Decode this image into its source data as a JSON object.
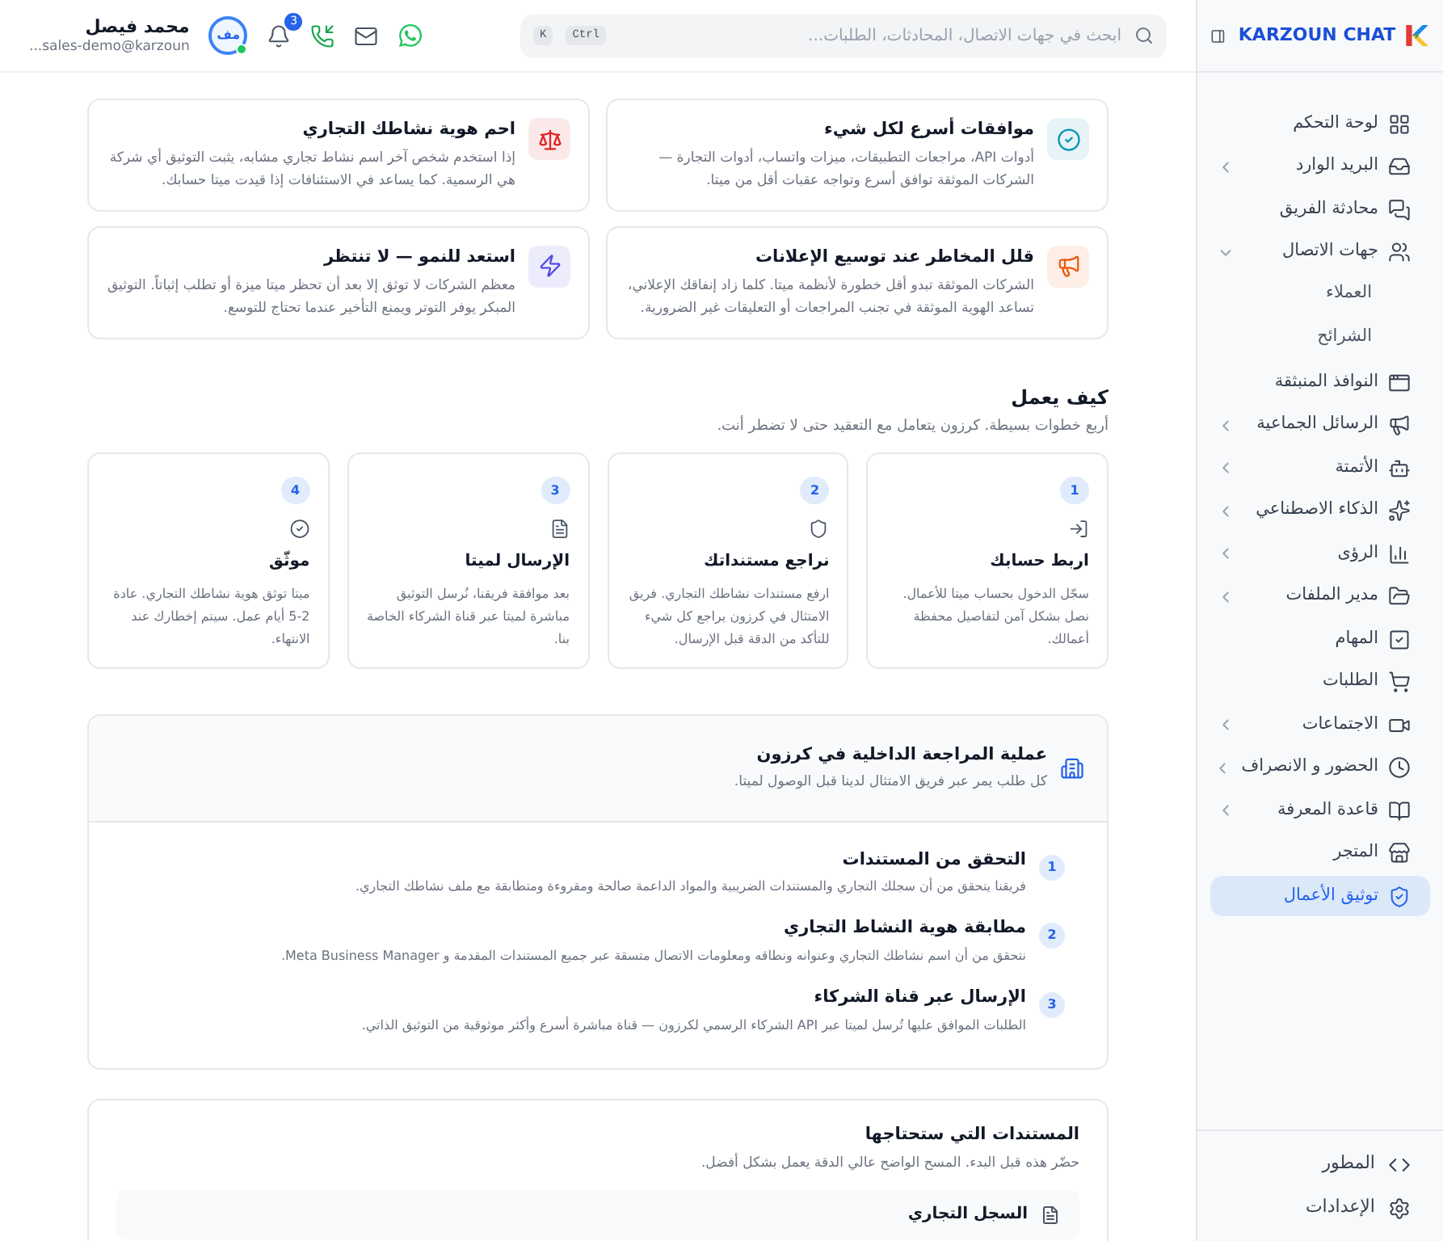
{
  "sidebar": {
    "logo_text": "KARZOUN CHAT",
    "items": [
      {
        "label": "لوحة التحكم",
        "selected": false
      },
      {
        "label": "البريد الوارد",
        "selected": false,
        "expanded": false
      },
      {
        "label": "محادثة الفريق",
        "selected": false
      },
      {
        "label": "جهات الاتصال",
        "selected": false,
        "expanded": true,
        "children": [
          {
            "label": "العملاء",
            "selected": false
          },
          {
            "label": "الشرائح",
            "selected": false
          }
        ]
      },
      {
        "label": "النوافذ المنبثقة",
        "selected": false
      },
      {
        "label": "الرسائل الجماعية",
        "selected": false,
        "expanded": false
      },
      {
        "label": "الأتمتة",
        "selected": false,
        "expanded": false
      },
      {
        "label": "الذكاء الاصطناعي",
        "selected": false,
        "expanded": false
      },
      {
        "label": "الرؤى",
        "selected": false,
        "expanded": false
      },
      {
        "label": "مدير الملفات",
        "selected": false,
        "expanded": false
      },
      {
        "label": "المهام",
        "selected": false
      },
      {
        "label": "الطلبات",
        "selected": false
      },
      {
        "label": "الاجتماعات",
        "selected": false,
        "expanded": false
      },
      {
        "label": "الحضور و الانصراف",
        "selected": false,
        "expanded": false
      },
      {
        "label": "قاعدة المعرفة",
        "selected": false,
        "expanded": false
      },
      {
        "label": "المتجر",
        "selected": false
      },
      {
        "label": "توثيق الأعمال",
        "selected": true
      }
    ],
    "footer_items": [
      {
        "label": "المطور"
      },
      {
        "label": "الإعدادات"
      }
    ]
  },
  "header": {
    "search": {
      "placeholder": "ابحث في جهات الاتصال، المحادثات، الطلبات...",
      "keys": [
        "Ctrl",
        "K"
      ]
    },
    "notifications_count": "3",
    "user": {
      "initials": "مف",
      "name": "محمد فيصل",
      "email": "sales-demo@karzoun...",
      "online": true
    }
  },
  "benefits": [
    {
      "title": "موافقات أسرع لكل شيء",
      "text": "أدوات API، مراجعات التطبيقات، ميزات واتساب، أدوات التجارة — الشركات الموثقة توافق أسرع وتواجه عقبات أقل من ميتا.",
      "color": "#0891b2"
    },
    {
      "title": "احم هوية نشاطك التجاري",
      "text": "إذا استخدم شخص آخر اسم نشاط تجاري مشابه، يثبت التوثيق أي شركة هي الرسمية. كما يساعد في الاستئنافات إذا قيدت ميتا حسابك.",
      "color": "#dc2626"
    },
    {
      "title": "قلل المخاطر عند توسيع الإعلانات",
      "text": "الشركات الموثقة تبدو أقل خطورة لأنظمة ميتا. كلما زاد إنفاقك الإعلاني، تساعد الهوية الموثقة في تجنب المراجعات أو التعليقات غير الضرورية.",
      "color": "#ea580c"
    },
    {
      "title": "استعد للنمو — لا تنتظر",
      "text": "معظم الشركات لا توثق إلا بعد أن تحظر ميتا ميزة أو تطلب إثباتاً. التوثيق المبكر يوفر التوتر ويمنع التأخير عندما تحتاج للتوسع.",
      "color": "#4f46e5"
    }
  ],
  "how_it_works": {
    "title": "كيف يعمل",
    "subtitle": "أربع خطوات بسيطة. كرزون يتعامل مع التعقيد حتى لا تضطر أنت.",
    "steps": [
      {
        "number": "1",
        "title": "اربط حسابك",
        "text": "سجّل الدخول بحساب ميتا للأعمال. نصل بشكل آمن لتفاصيل محفظة أعمالك."
      },
      {
        "number": "2",
        "title": "نراجع مستنداتك",
        "text": "ارفع مستندات نشاطك التجاري. فريق الامتثال في كرزون يراجع كل شيء للتأكد من الدقة قبل الإرسال."
      },
      {
        "number": "3",
        "title": "الإرسال لميتا",
        "text": "بعد موافقة فريقنا، نُرسل التوثيق مباشرة لميتا عبر قناة الشركاء الخاصة بنا."
      },
      {
        "number": "4",
        "title": "موثّق",
        "text": "ميتا توثق هوية نشاطك التجاري. عادة 2-5 أيام عمل. سيتم إخطارك عند الانتهاء."
      }
    ]
  },
  "review_process": {
    "title": "عملية المراجعة الداخلية في كرزون",
    "subtitle": "كل طلب يمر عبر فريق الامتثال لدينا قبل الوصول لميتا.",
    "items": [
      {
        "number": "1",
        "title": "التحقق من المستندات",
        "text": "فريقنا يتحقق من أن سجلك التجاري والمستندات الضريبية والمواد الداعمة صالحة ومقروءة ومتطابقة مع ملف نشاطك التجاري."
      },
      {
        "number": "2",
        "title": "مطابقة هوية النشاط التجاري",
        "text": "نتحقق من أن اسم نشاطك التجاري وعنوانه ونطاقه ومعلومات الاتصال متسقة عبر جميع المستندات المقدمة و Meta Business Manager."
      },
      {
        "number": "3",
        "title": "الإرسال عبر قناة الشركاء",
        "text": "الطلبات الموافق عليها تُرسل لميتا عبر API الشركاء الرسمي لكرزون — قناة مباشرة أسرع وأكثر موثوقية من التوثيق الذاتي."
      }
    ]
  },
  "documents": {
    "title": "المستندات التي ستحتاجها",
    "subtitle": "حضّر هذه قبل البدء. المسح الواضح عالي الدقة يعمل بشكل أفضل.",
    "items": [
      {
        "label": "السجل التجاري"
      }
    ]
  }
}
